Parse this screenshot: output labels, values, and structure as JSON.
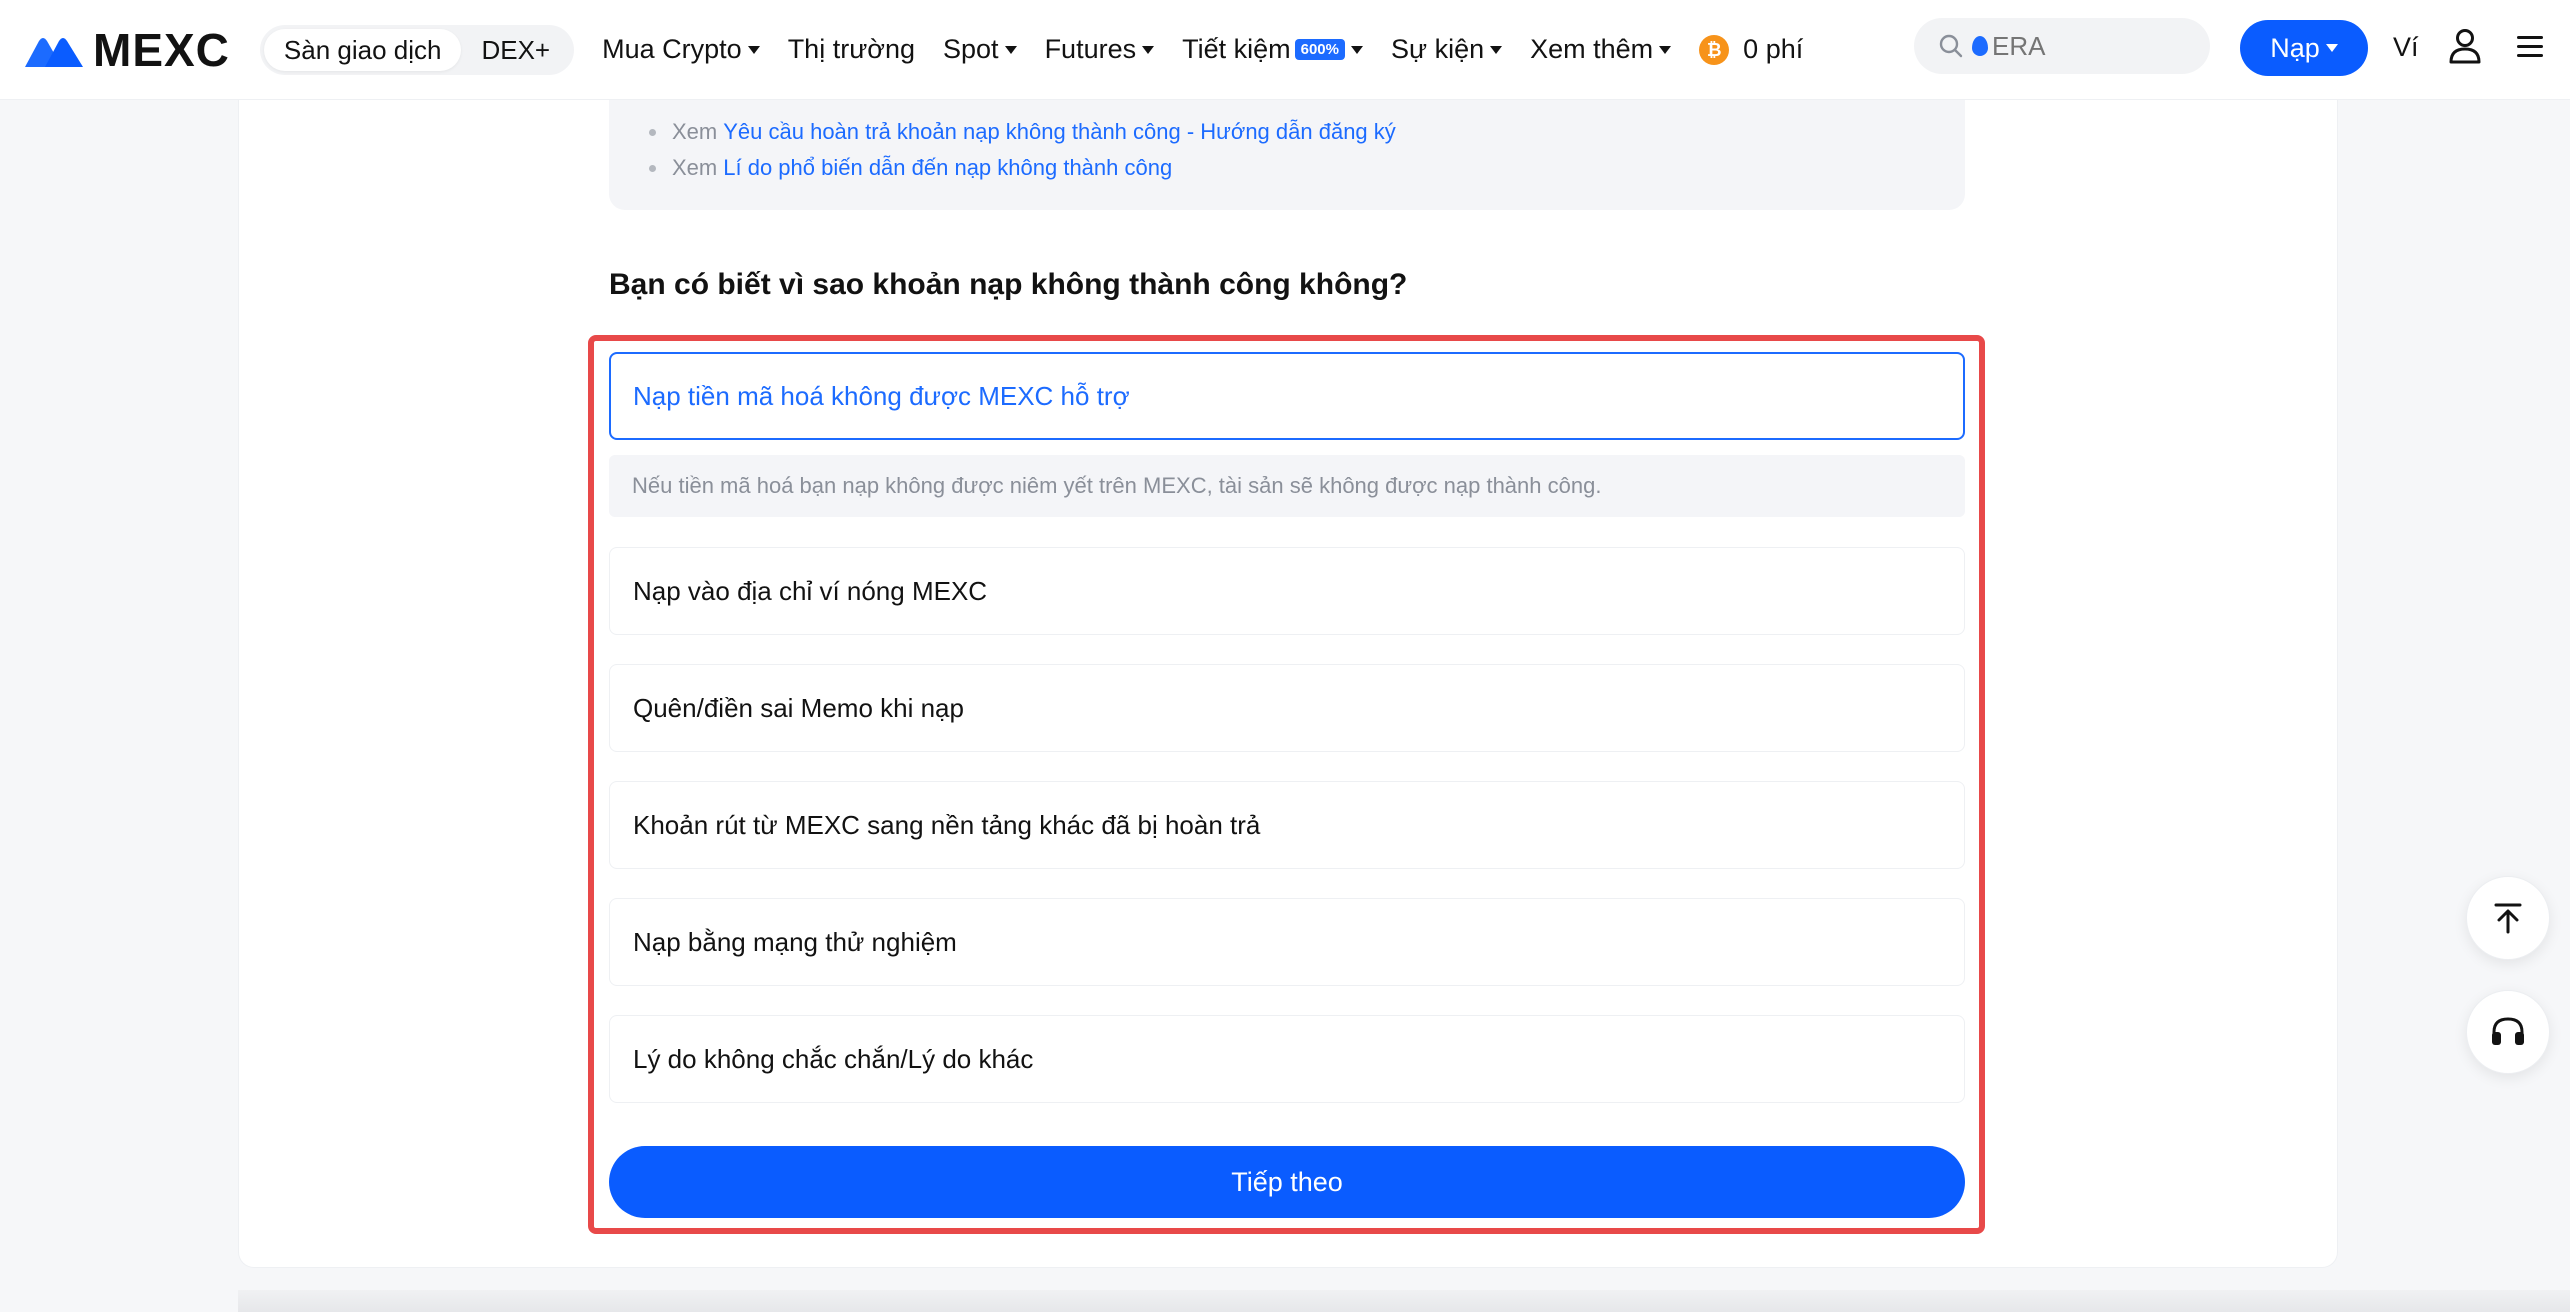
{
  "header": {
    "brand": "MEXC",
    "segments": [
      "Sàn giao dịch",
      "DEX+"
    ],
    "nav": [
      {
        "label": "Mua Crypto",
        "dropdown": true
      },
      {
        "label": "Thị trường",
        "dropdown": false
      },
      {
        "label": "Spot",
        "dropdown": true
      },
      {
        "label": "Futures",
        "dropdown": true
      },
      {
        "label": "Tiết kiệm",
        "dropdown": true,
        "badge": "600%"
      },
      {
        "label": "Sự kiện",
        "dropdown": true
      },
      {
        "label": "Xem thêm",
        "dropdown": true
      }
    ],
    "zero_fee": "0 phí",
    "search_placeholder": "ERA",
    "deposit_label": "Nạp",
    "wallet_label": "Ví"
  },
  "info": {
    "lines": [
      {
        "prefix": "Xem",
        "link": "Yêu cầu hoàn trả khoản nạp không thành công - Hướng dẫn đăng ký"
      },
      {
        "prefix": "Xem",
        "link": "Lí do phổ biến dẫn đến nạp không thành công"
      }
    ]
  },
  "question": "Bạn có biết vì sao khoản nạp không thành công không?",
  "options": [
    {
      "label": "Nạp tiền mã hoá không được MEXC hỗ trợ",
      "selected": true
    },
    {
      "label": "Nạp vào địa chỉ ví nóng MEXC",
      "selected": false
    },
    {
      "label": "Quên/điền sai Memo khi nạp",
      "selected": false
    },
    {
      "label": "Khoản rút từ MEXC sang nền tảng khác đã bị hoàn trả",
      "selected": false
    },
    {
      "label": "Nạp bằng mạng thử nghiệm",
      "selected": false
    },
    {
      "label": "Lý do không chắc chắn/Lý do khác",
      "selected": false
    }
  ],
  "selected_description": "Nếu tiền mã hoá bạn nạp không được niêm yết trên MEXC, tài sản sẽ không được nạp thành công.",
  "next_label": "Tiếp theo",
  "colors": {
    "accent": "#0a5cff",
    "link": "#1c6bff",
    "highlight_frame": "#e84949",
    "bitcoin": "#f7931a"
  },
  "icons": [
    "mexc-logo-icon",
    "bitcoin-icon",
    "search-icon",
    "user-icon",
    "menu-icon",
    "scroll-top-icon",
    "headset-icon"
  ]
}
